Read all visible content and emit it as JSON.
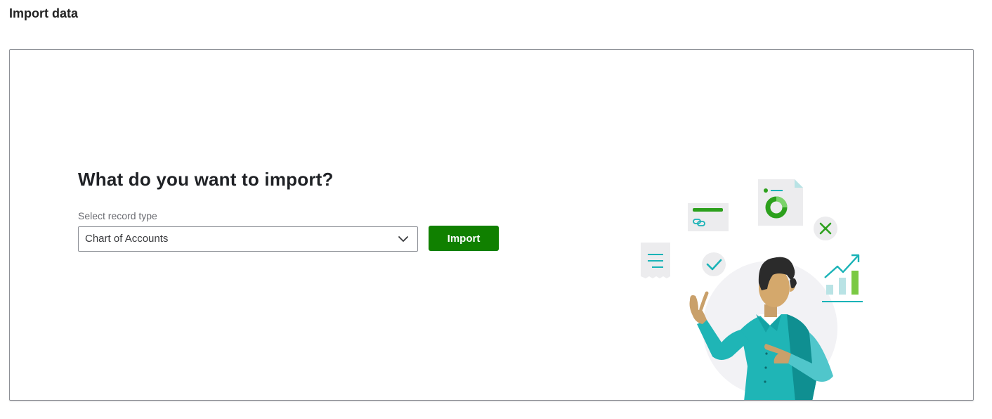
{
  "page": {
    "title": "Import data"
  },
  "main": {
    "heading": "What do you want to import?",
    "record_type": {
      "label": "Select record type",
      "selected": "Chart of Accounts"
    },
    "import_button": "Import"
  },
  "illustration": {
    "description_icons": [
      "receipt-icon",
      "link-card-icon",
      "report-document-icon",
      "checkmark-icon",
      "close-icon",
      "growth-chart-icon",
      "person-pointing"
    ]
  },
  "colors": {
    "primary_button": "#108000",
    "teal": "#1ab3b7",
    "green": "#2ca01c"
  }
}
